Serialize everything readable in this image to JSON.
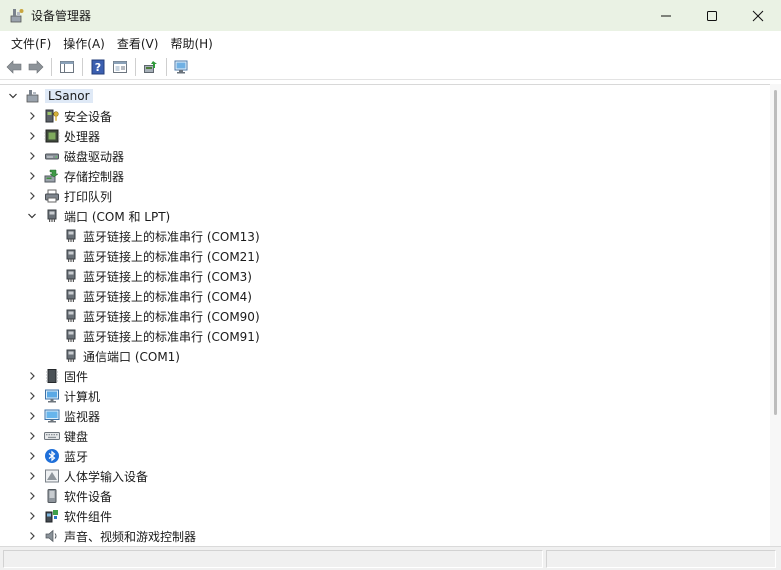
{
  "window": {
    "title": "设备管理器"
  },
  "menu": [
    "文件(F)",
    "操作(A)",
    "查看(V)",
    "帮助(H)"
  ],
  "tree": {
    "root": "LSanor",
    "categories": [
      {
        "label": "安全设备",
        "icon": "security-device-icon",
        "expanded": false
      },
      {
        "label": "处理器",
        "icon": "processor-icon",
        "expanded": false
      },
      {
        "label": "磁盘驱动器",
        "icon": "disk-drive-icon",
        "expanded": false
      },
      {
        "label": "存储控制器",
        "icon": "storage-controller-icon",
        "expanded": false
      },
      {
        "label": "打印队列",
        "icon": "printer-icon",
        "expanded": false
      },
      {
        "label": "端口 (COM 和 LPT)",
        "icon": "port-icon",
        "expanded": true,
        "children": [
          "蓝牙链接上的标准串行 (COM13)",
          "蓝牙链接上的标准串行 (COM21)",
          "蓝牙链接上的标准串行 (COM3)",
          "蓝牙链接上的标准串行 (COM4)",
          "蓝牙链接上的标准串行 (COM90)",
          "蓝牙链接上的标准串行 (COM91)",
          "通信端口 (COM1)"
        ]
      },
      {
        "label": "固件",
        "icon": "firmware-icon",
        "expanded": false
      },
      {
        "label": "计算机",
        "icon": "computer-icon",
        "expanded": false
      },
      {
        "label": "监视器",
        "icon": "monitor-icon",
        "expanded": false
      },
      {
        "label": "键盘",
        "icon": "keyboard-icon",
        "expanded": false
      },
      {
        "label": "蓝牙",
        "icon": "bluetooth-icon",
        "expanded": false
      },
      {
        "label": "人体学输入设备",
        "icon": "hid-icon",
        "expanded": false
      },
      {
        "label": "软件设备",
        "icon": "software-device-icon",
        "expanded": false
      },
      {
        "label": "软件组件",
        "icon": "software-component-icon",
        "expanded": false
      },
      {
        "label": "声音、视频和游戏控制器",
        "icon": "audio-icon",
        "expanded": false
      }
    ]
  },
  "colors": {
    "titlebar": "#eaf2e4",
    "selection": "#dfe9f6",
    "accent": "#1e6fd9"
  }
}
